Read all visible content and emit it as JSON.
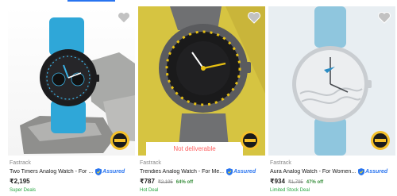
{
  "products": [
    {
      "brand": "Fastrack",
      "title": "Two Timers Analog Watch - For ...",
      "assured_label": "Assured",
      "price": "₹2,195",
      "mrp": "",
      "discount": "",
      "deal": "Super Deals",
      "overlay": ""
    },
    {
      "brand": "Fastrack",
      "title": "Trendies Analog Watch - For Me...",
      "assured_label": "Assured",
      "price": "₹787",
      "mrp": "₹2,195",
      "discount": "64% off",
      "deal": "Hot Deal",
      "overlay": "Not deliverable"
    },
    {
      "brand": "Fastrack",
      "title": "Aura Analog Watch - For Women...",
      "assured_label": "Assured",
      "price": "₹934",
      "mrp": "₹1,795",
      "discount": "47% off",
      "deal": "Limited Stock Deal",
      "overlay": ""
    }
  ],
  "icons": {
    "wishlist": "heart-icon",
    "assured": "assured-shield-icon",
    "badge": "quality-badge-icon"
  },
  "colors": {
    "accent": "#2874f0",
    "discount": "#388e3c",
    "deal": "#26a541",
    "not_deliverable": "#ff6161"
  }
}
